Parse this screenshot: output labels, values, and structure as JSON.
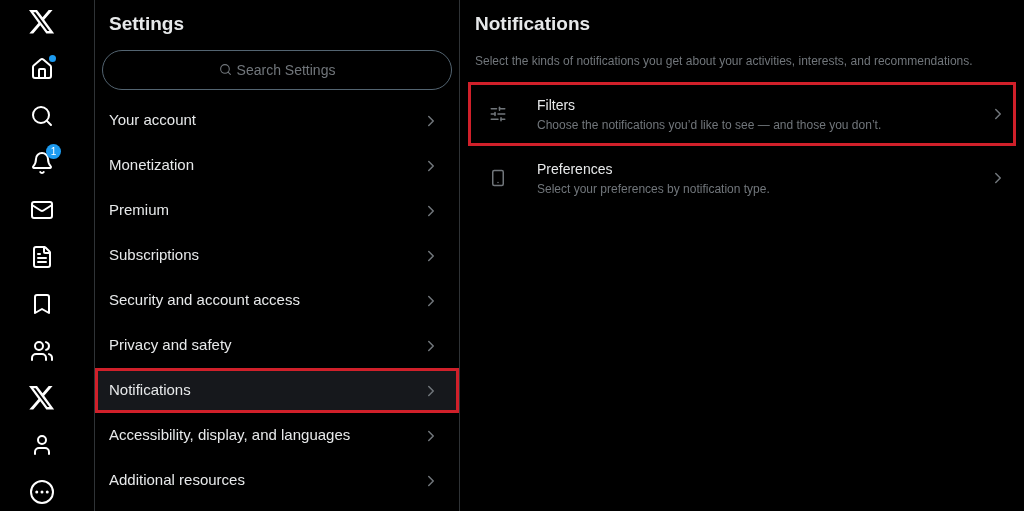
{
  "nav": [
    {
      "kind": "x-logo"
    },
    {
      "kind": "home",
      "dot": true
    },
    {
      "kind": "search"
    },
    {
      "kind": "bell",
      "badge": "1"
    },
    {
      "kind": "mail"
    },
    {
      "kind": "list"
    },
    {
      "kind": "bookmark"
    },
    {
      "kind": "people"
    },
    {
      "kind": "x-logo"
    },
    {
      "kind": "person"
    },
    {
      "kind": "more"
    }
  ],
  "settings": {
    "title": "Settings",
    "search": {
      "placeholder": "Search Settings"
    },
    "items": [
      {
        "label": "Your account",
        "selected": false,
        "highlighted": false
      },
      {
        "label": "Monetization",
        "selected": false,
        "highlighted": false
      },
      {
        "label": "Premium",
        "selected": false,
        "highlighted": false
      },
      {
        "label": "Subscriptions",
        "selected": false,
        "highlighted": false
      },
      {
        "label": "Security and account access",
        "selected": false,
        "highlighted": false
      },
      {
        "label": "Privacy and safety",
        "selected": false,
        "highlighted": false
      },
      {
        "label": "Notifications",
        "selected": true,
        "highlighted": true
      },
      {
        "label": "Accessibility, display, and languages",
        "selected": false,
        "highlighted": false
      },
      {
        "label": "Additional resources",
        "selected": false,
        "highlighted": false
      }
    ]
  },
  "notifications": {
    "title": "Notifications",
    "description": "Select the kinds of notifications you get about your activities, interests, and recommendations.",
    "options": [
      {
        "kind": "sliders",
        "title": "Filters",
        "subtitle": "Choose the notifications you’d like to see — and those you don’t.",
        "highlighted": true
      },
      {
        "kind": "device",
        "title": "Preferences",
        "subtitle": "Select your preferences by notification type.",
        "highlighted": false
      }
    ]
  }
}
